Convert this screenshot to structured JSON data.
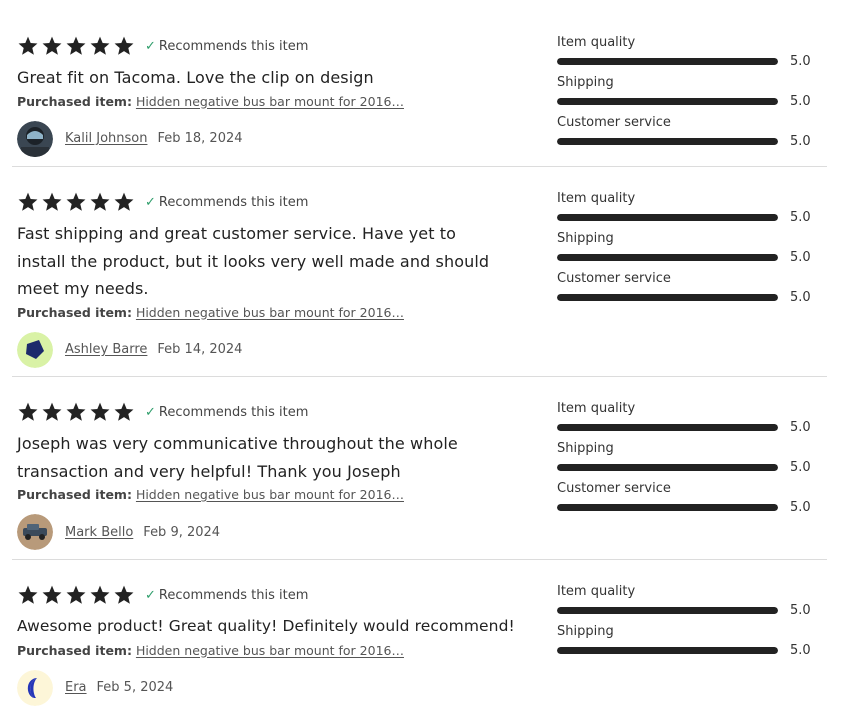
{
  "reviews": [
    {
      "rating": 5,
      "recommends_label": "Recommends this item",
      "text": "Great fit on Tacoma. Love the clip on design",
      "purchased_label": "Purchased item:",
      "purchased_item": "Hidden negative bus bar mount for 2016…",
      "author": "Kalil Johnson",
      "date": "Feb 18, 2024",
      "avatar_icon": "user-photo-avatar",
      "categories": [
        {
          "label": "Item quality",
          "value": "5.0",
          "fraction": 1.0
        },
        {
          "label": "Shipping",
          "value": "5.0",
          "fraction": 1.0
        },
        {
          "label": "Customer service",
          "value": "5.0",
          "fraction": 1.0
        }
      ]
    },
    {
      "rating": 5,
      "recommends_label": "Recommends this item",
      "text": "Fast shipping and great customer service. Have yet to install the product, but it looks very well made and should meet my needs.",
      "purchased_label": "Purchased item:",
      "purchased_item": "Hidden negative bus bar mount for 2016…",
      "author": "Ashley Barre",
      "date": "Feb 14, 2024",
      "avatar_icon": "pentagon-avatar",
      "categories": [
        {
          "label": "Item quality",
          "value": "5.0",
          "fraction": 1.0
        },
        {
          "label": "Shipping",
          "value": "5.0",
          "fraction": 1.0
        },
        {
          "label": "Customer service",
          "value": "5.0",
          "fraction": 1.0
        }
      ]
    },
    {
      "rating": 5,
      "recommends_label": "Recommends this item",
      "text": "Joseph was very communicative throughout the whole transaction and very helpful! Thank you Joseph",
      "purchased_label": "Purchased item:",
      "purchased_item": "Hidden negative bus bar mount for 2016…",
      "author": "Mark Bello",
      "date": "Feb 9, 2024",
      "avatar_icon": "truck-photo-avatar",
      "categories": [
        {
          "label": "Item quality",
          "value": "5.0",
          "fraction": 1.0
        },
        {
          "label": "Shipping",
          "value": "5.0",
          "fraction": 1.0
        },
        {
          "label": "Customer service",
          "value": "5.0",
          "fraction": 1.0
        }
      ]
    },
    {
      "rating": 5,
      "recommends_label": "Recommends this item",
      "text": "Awesome product! Great quality! Definitely would recommend!",
      "purchased_label": "Purchased item:",
      "purchased_item": "Hidden negative bus bar mount for 2016…",
      "author": "Era",
      "date": "Feb 5, 2024",
      "avatar_icon": "crescent-avatar",
      "categories": [
        {
          "label": "Item quality",
          "value": "5.0",
          "fraction": 1.0
        },
        {
          "label": "Shipping",
          "value": "5.0",
          "fraction": 1.0
        }
      ]
    }
  ],
  "colors": {
    "star": "#222222",
    "check": "#2f9e6b",
    "bar_fill": "#222222",
    "bar_track": "#e0e0e0",
    "divider": "#dcdcdc"
  }
}
